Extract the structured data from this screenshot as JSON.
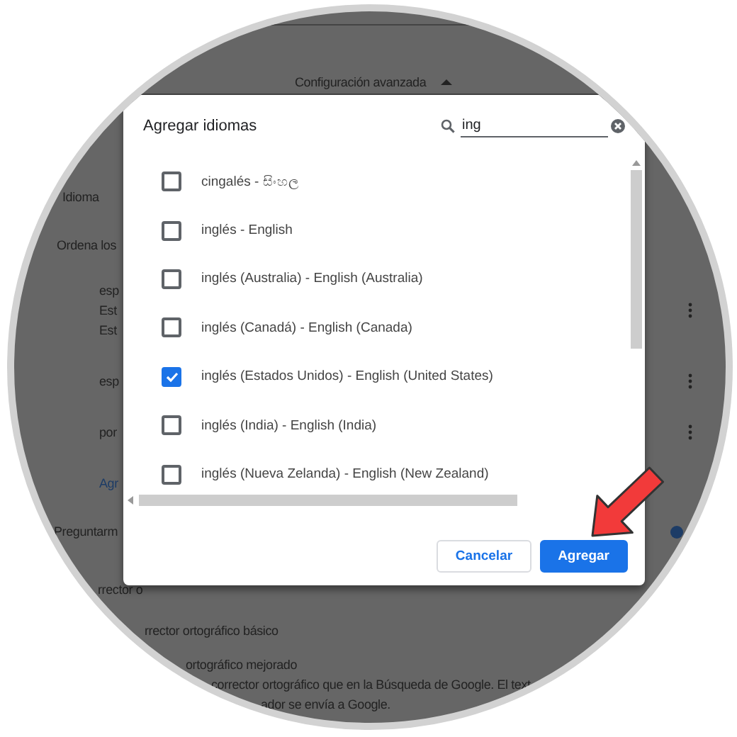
{
  "background": {
    "section_header": "Configuración avanzada",
    "language_heading": "Idioma",
    "order_label": "Ordena los",
    "languages": [
      {
        "name": "esp",
        "notes": [
          "Est",
          "Est"
        ]
      },
      {
        "name": "esp"
      },
      {
        "name": "por"
      }
    ],
    "add_link": "Agr",
    "ask_label": "Preguntarm",
    "ask_toggle": {
      "on": true
    },
    "spellcheck_label": "rrector o",
    "spell_options": [
      {
        "title": "rrector ortográfico básico"
      },
      {
        "title": "ortográfico mejorado",
        "description": [
          "corrector ortográfico que en la Búsqueda de Google. El text",
          "ador se envía a Google."
        ]
      }
    ]
  },
  "dialog": {
    "title": "Agregar idiomas",
    "search": {
      "value": "ing"
    },
    "languages": [
      {
        "label": "cingalés - සිංහල",
        "checked": false
      },
      {
        "label": "inglés - English",
        "checked": false
      },
      {
        "label": "inglés (Australia) - English (Australia)",
        "checked": false
      },
      {
        "label": "inglés (Canadá) - English (Canada)",
        "checked": false
      },
      {
        "label": "inglés (Estados Unidos) - English (United States)",
        "checked": true
      },
      {
        "label": "inglés (India) - English (India)",
        "checked": false
      },
      {
        "label": "inglés (Nueva Zelanda) - English (New Zealand)",
        "checked": false
      }
    ],
    "buttons": [
      {
        "label": "Cancelar",
        "kind": "secondary"
      },
      {
        "label": "Agregar",
        "kind": "primary"
      }
    ]
  }
}
